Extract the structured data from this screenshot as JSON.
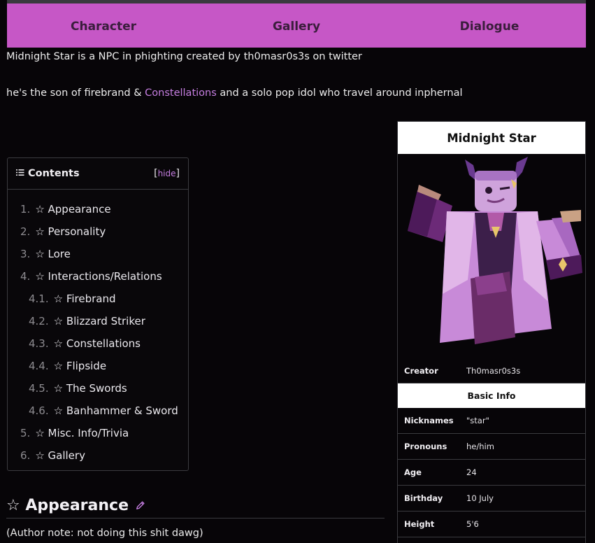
{
  "tabs": [
    {
      "label": "Character"
    },
    {
      "label": "Gallery"
    },
    {
      "label": "Dialogue"
    }
  ],
  "intro": {
    "line1": "Midnight Star is a NPC in phighting created by th0masr0s3s on twitter",
    "line2_before": "he's the son of firebrand & ",
    "line2_link": "Constellations",
    "line2_after": " and a solo pop idol who travel around inphernal"
  },
  "toc": {
    "icon": "list-icon",
    "title": "Contents",
    "bracket_open": "[",
    "hide_label": "hide",
    "bracket_close": "]",
    "items": [
      {
        "num": "1.",
        "label": "☆ Appearance",
        "level": 1
      },
      {
        "num": "2.",
        "label": "☆ Personality",
        "level": 1
      },
      {
        "num": "3.",
        "label": "☆ Lore",
        "level": 1
      },
      {
        "num": "4.",
        "label": "☆ Interactions/Relations",
        "level": 1
      },
      {
        "num": "4.1.",
        "label": "☆ Firebrand",
        "level": 2
      },
      {
        "num": "4.2.",
        "label": "☆ Blizzard Striker",
        "level": 2
      },
      {
        "num": "4.3.",
        "label": "☆ Constellations",
        "level": 2
      },
      {
        "num": "4.4.",
        "label": "☆ Flipside",
        "level": 2
      },
      {
        "num": "4.5.",
        "label": "☆ The Swords",
        "level": 2
      },
      {
        "num": "4.6.",
        "label": "☆ Banhammer & Sword",
        "level": 2
      },
      {
        "num": "5.",
        "label": "☆ Misc. Info/Trivia",
        "level": 1
      },
      {
        "num": "6.",
        "label": "☆ Gallery",
        "level": 1
      }
    ]
  },
  "section": {
    "heading": "☆ Appearance",
    "edit_icon": "pencil-icon",
    "note": "(Author note: not doing this shit dawg)"
  },
  "infobox": {
    "title": "Midnight Star",
    "creator_label": "Creator",
    "creator_value": "Th0masr0s3s",
    "basic_info_label": "Basic Info",
    "rows": [
      {
        "label": "Nicknames",
        "value": "\"star\""
      },
      {
        "label": "Pronouns",
        "value": "he/him"
      },
      {
        "label": "Age",
        "value": "24"
      },
      {
        "label": "Birthday",
        "value": "10 July"
      },
      {
        "label": "Height",
        "value": "5'6"
      }
    ]
  },
  "colors": {
    "tab_bar": "#c657c6",
    "tab_text": "#3a1d3c",
    "link": "#c57ee0",
    "background": "#070508"
  }
}
